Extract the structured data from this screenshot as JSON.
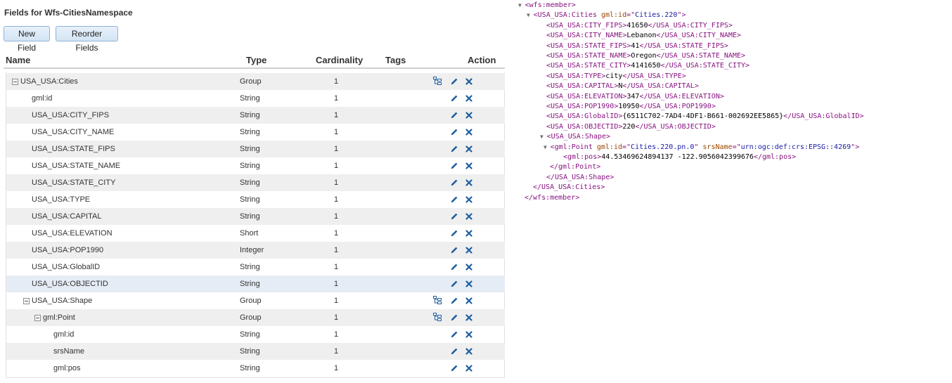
{
  "left_panel": {
    "title": "Fields for Wfs-CitiesNamespace",
    "buttons": {
      "new_field": "New Field",
      "reorder_fields": "Reorder Fields"
    },
    "columns": {
      "name": "Name",
      "type": "Type",
      "cardinality": "Cardinality",
      "tags": "Tags",
      "action": "Action"
    },
    "rows": [
      {
        "name": "USA_USA:Cities",
        "type": "Group",
        "cardinality": "1",
        "level": 0,
        "expandable": true
      },
      {
        "name": "gml:id",
        "type": "String",
        "cardinality": "1",
        "level": 1,
        "expandable": false
      },
      {
        "name": "USA_USA:CITY_FIPS",
        "type": "String",
        "cardinality": "1",
        "level": 1,
        "expandable": false
      },
      {
        "name": "USA_USA:CITY_NAME",
        "type": "String",
        "cardinality": "1",
        "level": 1,
        "expandable": false
      },
      {
        "name": "USA_USA:STATE_FIPS",
        "type": "String",
        "cardinality": "1",
        "level": 1,
        "expandable": false
      },
      {
        "name": "USA_USA:STATE_NAME",
        "type": "String",
        "cardinality": "1",
        "level": 1,
        "expandable": false
      },
      {
        "name": "USA_USA:STATE_CITY",
        "type": "String",
        "cardinality": "1",
        "level": 1,
        "expandable": false
      },
      {
        "name": "USA_USA:TYPE",
        "type": "String",
        "cardinality": "1",
        "level": 1,
        "expandable": false
      },
      {
        "name": "USA_USA:CAPITAL",
        "type": "String",
        "cardinality": "1",
        "level": 1,
        "expandable": false
      },
      {
        "name": "USA_USA:ELEVATION",
        "type": "Short",
        "cardinality": "1",
        "level": 1,
        "expandable": false
      },
      {
        "name": "USA_USA:POP1990",
        "type": "Integer",
        "cardinality": "1",
        "level": 1,
        "expandable": false
      },
      {
        "name": "USA_USA:GlobalID",
        "type": "String",
        "cardinality": "1",
        "level": 1,
        "expandable": false
      },
      {
        "name": "USA_USA:OBJECTID",
        "type": "String",
        "cardinality": "1",
        "level": 1,
        "expandable": false
      },
      {
        "name": "USA_USA:Shape",
        "type": "Group",
        "cardinality": "1",
        "level": 1,
        "expandable": true
      },
      {
        "name": "gml:Point",
        "type": "Group",
        "cardinality": "1",
        "level": 2,
        "expandable": true
      },
      {
        "name": "gml:id",
        "type": "String",
        "cardinality": "1",
        "level": 3,
        "expandable": false
      },
      {
        "name": "srsName",
        "type": "String",
        "cardinality": "1",
        "level": 3,
        "expandable": false
      },
      {
        "name": "gml:pos",
        "type": "String",
        "cardinality": "1",
        "level": 3,
        "expandable": false
      }
    ],
    "icons": {
      "tree": "hierarchy-icon",
      "edit": "pencil-icon",
      "delete": "close-icon"
    },
    "colors": {
      "button_border": "#8fb3d9",
      "icon_blue": "#1f5f9f",
      "alt_row": "#efefef",
      "selected_row": "#e5ecf5"
    }
  },
  "xml_view": {
    "lines": [
      {
        "indent": 0,
        "arrow": "▼",
        "parts": [
          [
            "tag",
            "<wfs:member>"
          ]
        ]
      },
      {
        "indent": 1,
        "arrow": "▼",
        "parts": [
          [
            "tag",
            "<USA_USA:Cities "
          ],
          [
            "attr",
            "gml:id"
          ],
          [
            "tag",
            "=\""
          ],
          [
            "aval",
            "Cities.220"
          ],
          [
            "tag",
            "\">"
          ]
        ]
      },
      {
        "indent": 2,
        "arrow": "",
        "parts": [
          [
            "tag",
            "<USA_USA:CITY_FIPS>"
          ],
          [
            "txt",
            "41650"
          ],
          [
            "tag",
            "</USA_USA:CITY_FIPS>"
          ]
        ]
      },
      {
        "indent": 2,
        "arrow": "",
        "parts": [
          [
            "tag",
            "<USA_USA:CITY_NAME>"
          ],
          [
            "txt",
            "Lebanon"
          ],
          [
            "tag",
            "</USA_USA:CITY_NAME>"
          ]
        ]
      },
      {
        "indent": 2,
        "arrow": "",
        "parts": [
          [
            "tag",
            "<USA_USA:STATE_FIPS>"
          ],
          [
            "txt",
            "41"
          ],
          [
            "tag",
            "</USA_USA:STATE_FIPS>"
          ]
        ]
      },
      {
        "indent": 2,
        "arrow": "",
        "parts": [
          [
            "tag",
            "<USA_USA:STATE_NAME>"
          ],
          [
            "txt",
            "Oregon"
          ],
          [
            "tag",
            "</USA_USA:STATE_NAME>"
          ]
        ]
      },
      {
        "indent": 2,
        "arrow": "",
        "parts": [
          [
            "tag",
            "<USA_USA:STATE_CITY>"
          ],
          [
            "txt",
            "4141650"
          ],
          [
            "tag",
            "</USA_USA:STATE_CITY>"
          ]
        ]
      },
      {
        "indent": 2,
        "arrow": "",
        "parts": [
          [
            "tag",
            "<USA_USA:TYPE>"
          ],
          [
            "txt",
            "city"
          ],
          [
            "tag",
            "</USA_USA:TYPE>"
          ]
        ]
      },
      {
        "indent": 2,
        "arrow": "",
        "parts": [
          [
            "tag",
            "<USA_USA:CAPITAL>"
          ],
          [
            "txt",
            "N"
          ],
          [
            "tag",
            "</USA_USA:CAPITAL>"
          ]
        ]
      },
      {
        "indent": 2,
        "arrow": "",
        "parts": [
          [
            "tag",
            "<USA_USA:ELEVATION>"
          ],
          [
            "txt",
            "347"
          ],
          [
            "tag",
            "</USA_USA:ELEVATION>"
          ]
        ]
      },
      {
        "indent": 2,
        "arrow": "",
        "parts": [
          [
            "tag",
            "<USA_USA:POP1990>"
          ],
          [
            "txt",
            "10950"
          ],
          [
            "tag",
            "</USA_USA:POP1990>"
          ]
        ]
      },
      {
        "indent": 2,
        "arrow": "",
        "parts": [
          [
            "tag",
            "<USA_USA:GlobalID>"
          ],
          [
            "txt",
            "{6511C702-7AD4-4DF1-B661-002692EE5865}"
          ],
          [
            "tag",
            "</USA_USA:GlobalID>"
          ]
        ]
      },
      {
        "indent": 2,
        "arrow": "",
        "parts": [
          [
            "tag",
            "<USA_USA:OBJECTID>"
          ],
          [
            "txt",
            "220"
          ],
          [
            "tag",
            "</USA_USA:OBJECTID>"
          ]
        ]
      },
      {
        "indent": 2,
        "arrow": "▼",
        "parts": [
          [
            "tag",
            "<USA_USA:Shape>"
          ]
        ]
      },
      {
        "indent": 3,
        "arrow": "▼",
        "parts": [
          [
            "tag",
            "<gml:Point "
          ],
          [
            "attr",
            "gml:id"
          ],
          [
            "tag",
            "=\""
          ],
          [
            "aval",
            "Cities.220.pn.0"
          ],
          [
            "tag",
            "\" "
          ],
          [
            "attr",
            "srsName"
          ],
          [
            "tag",
            "=\""
          ],
          [
            "aval",
            "urn:ogc:def:crs:EPSG::4269"
          ],
          [
            "tag",
            "\">"
          ]
        ]
      },
      {
        "indent": 4,
        "arrow": "",
        "parts": [
          [
            "tag",
            "<gml:pos>"
          ],
          [
            "txt",
            "44.53469624894137 -122.9056042399676"
          ],
          [
            "tag",
            "</gml:pos>"
          ]
        ]
      },
      {
        "indent": 3,
        "arrow": "",
        "parts": [
          [
            "tag",
            "</gml:Point>"
          ]
        ]
      },
      {
        "indent": 2,
        "arrow": "",
        "parts": [
          [
            "tag",
            "</USA_USA:Shape>"
          ]
        ]
      },
      {
        "indent": 1,
        "arrow": "",
        "parts": [
          [
            "tag",
            "</USA_USA:Cities>"
          ]
        ]
      },
      {
        "indent": 0,
        "arrow": "",
        "parts": [
          [
            "tag",
            "</wfs:member>"
          ]
        ]
      }
    ],
    "colors": {
      "tag": "#881280",
      "attr": "#994500",
      "attr_value": "#1a1aa6",
      "text": "#000000"
    }
  }
}
